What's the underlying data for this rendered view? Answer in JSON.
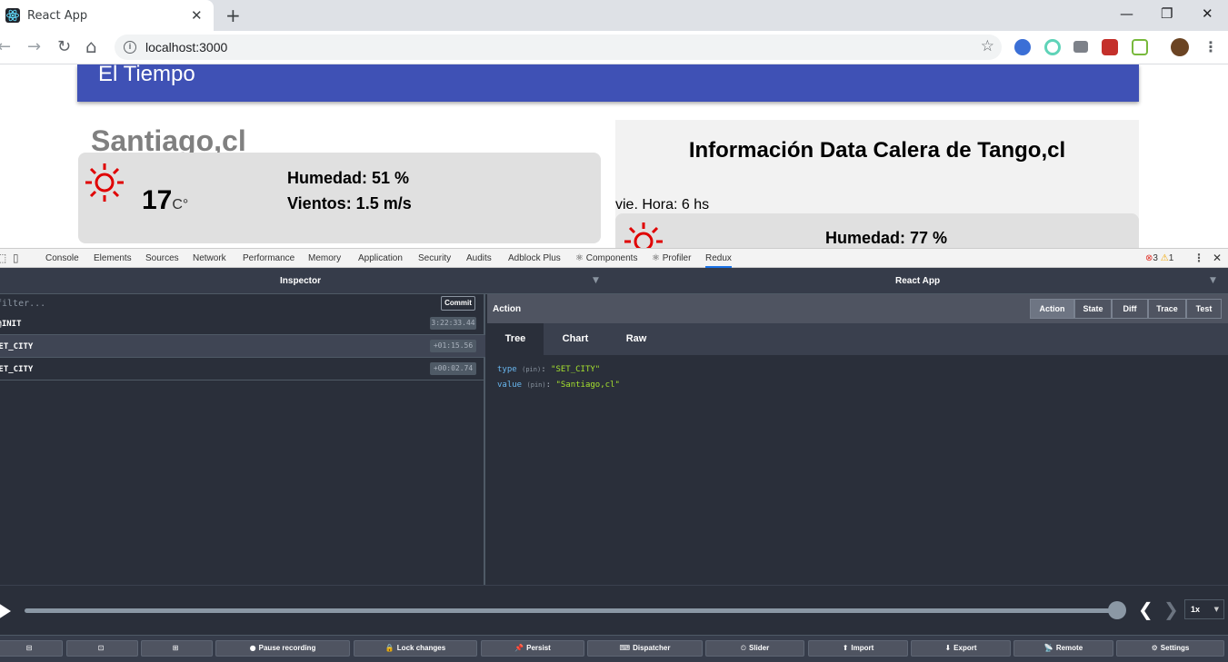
{
  "browser": {
    "tab_title": "React App",
    "tab_close": "✕",
    "new_tab": "+",
    "window_controls": [
      "—",
      "❐",
      "✕"
    ],
    "url": "localhost:3000",
    "info_icon": "i",
    "back": "←",
    "forward": "→",
    "reload": "↻",
    "home": "⌂",
    "star": "☆",
    "menu": "⋮",
    "extension_icons": [
      "edge-like-icon",
      "target-icon",
      "camera-icon",
      "red-puzzle-icon",
      "nodejs-icon",
      "avatar-horse-icon"
    ]
  },
  "app": {
    "title": "El Tiempo",
    "city": "Santiago,cl",
    "weather": {
      "temperature": "17",
      "unit": "C°",
      "humidity": "Humedad: 51 %",
      "wind": "Vientos: 1.5 m/s",
      "icon": "sun-icon"
    },
    "forecast": {
      "title": "Información Data Calera de Tango,cl",
      "day": "vie. Hora: 6 hs",
      "humidity": "Humedad: 77 %",
      "icon": "sun-icon"
    },
    "colors": {
      "appbar": "#3f51b5",
      "sun": "#e00000"
    }
  },
  "devtools": {
    "tabs": [
      "Console",
      "Elements",
      "Sources",
      "Network",
      "Performance",
      "Memory",
      "Application",
      "Security",
      "Audits",
      "Adblock Plus",
      "⚛ Components",
      "⚛ Profiler",
      "Redux"
    ],
    "active_tab": "Redux",
    "errors": "3",
    "warnings": "1",
    "close": "✕",
    "more": "⋮"
  },
  "redux": {
    "header_left": "Inspector",
    "header_right": "React App",
    "filter_placeholder": "filter...",
    "commit_label": "Commit",
    "actions": [
      {
        "name": "@@INIT",
        "time": "3:22:33.44"
      },
      {
        "name": "SET_CITY",
        "time": "+01:15.56"
      },
      {
        "name": "SET_CITY",
        "time": "+00:02.74"
      }
    ],
    "action_title": "Action",
    "view_buttons": [
      "Action",
      "State",
      "Diff",
      "Trace",
      "Test"
    ],
    "active_view": "Action",
    "subtabs": [
      "Tree",
      "Chart",
      "Raw"
    ],
    "active_subtab": "Tree",
    "tree": [
      {
        "key": "type",
        "pin": "(pin)",
        "value": "\"SET_CITY\""
      },
      {
        "key": "value",
        "pin": "(pin)",
        "value": "\"Santiago,cl\""
      }
    ],
    "slider": {
      "position": 1.0,
      "speed": "1x",
      "prev": "❮",
      "next": "❯"
    },
    "bottom_buttons": [
      {
        "label": "",
        "icon": "⊟"
      },
      {
        "label": "",
        "icon": "⊡"
      },
      {
        "label": "",
        "icon": "⊞"
      },
      {
        "label": "Pause recording",
        "icon": "●"
      },
      {
        "label": "Lock changes",
        "icon": "🔒"
      },
      {
        "label": "Persist",
        "icon": "📌"
      },
      {
        "label": "Dispatcher",
        "icon": "⌨"
      },
      {
        "label": "Slider",
        "icon": "⏲"
      },
      {
        "label": "Import",
        "icon": "⬆"
      },
      {
        "label": "Export",
        "icon": "⬇"
      },
      {
        "label": "Remote",
        "icon": "📡"
      },
      {
        "label": "Settings",
        "icon": "⚙"
      }
    ]
  }
}
